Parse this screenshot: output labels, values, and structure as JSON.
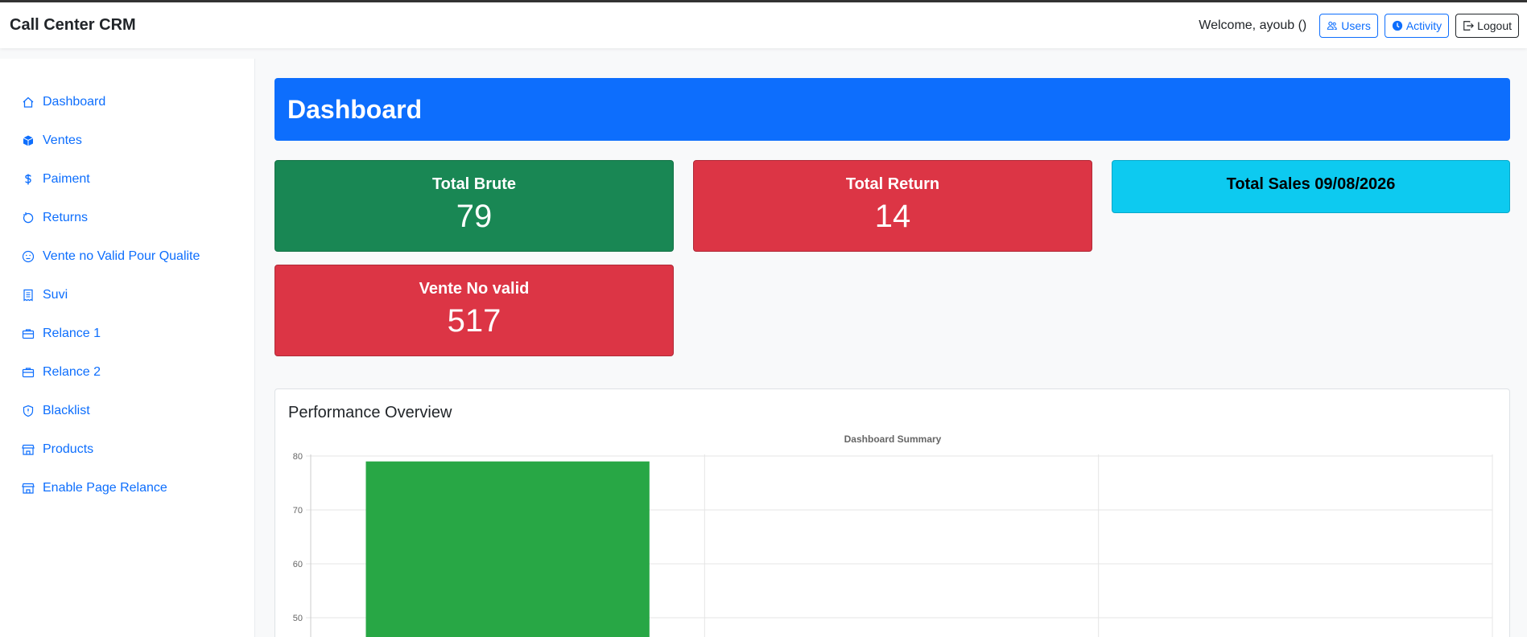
{
  "app": {
    "title": "Call Center CRM"
  },
  "header": {
    "welcome": "Welcome, ayoub ()",
    "buttons": {
      "users": "Users",
      "activity": "Activity",
      "logout": "Logout"
    }
  },
  "sidebar": {
    "items": [
      {
        "label": "Dashboard",
        "icon": "home-icon"
      },
      {
        "label": "Ventes",
        "icon": "box-icon"
      },
      {
        "label": "Paiment",
        "icon": "dollar-icon"
      },
      {
        "label": "Returns",
        "icon": "refresh-icon"
      },
      {
        "label": "Vente no Valid Pour Qualite",
        "icon": "neutral-face-icon"
      },
      {
        "label": "Suvi",
        "icon": "receipt-icon"
      },
      {
        "label": "Relance 1",
        "icon": "briefcase-icon"
      },
      {
        "label": "Relance 2",
        "icon": "briefcase-icon"
      },
      {
        "label": "Blacklist",
        "icon": "shield-icon"
      },
      {
        "label": "Products",
        "icon": "shop-icon"
      },
      {
        "label": "Enable Page Relance",
        "icon": "shop-icon"
      }
    ]
  },
  "page": {
    "title": "Dashboard"
  },
  "cards": {
    "total_brute": {
      "title": "Total Brute",
      "value": "79"
    },
    "total_return": {
      "title": "Total Return",
      "value": "14"
    },
    "total_sales": {
      "title": "Total Sales 09/08/2026"
    },
    "vente_no_valid": {
      "title": "Vente No valid",
      "value": "517"
    }
  },
  "colors": {
    "primary": "#0d6efd",
    "success": "#198754",
    "danger": "#dc3545",
    "info": "#0dcaf0",
    "bar": "#28a745"
  },
  "performance": {
    "title": "Performance Overview"
  },
  "chart_data": {
    "type": "bar",
    "title": "Dashboard Summary",
    "categories_visible": 3,
    "values": [
      79
    ],
    "bar_color": "#28a745",
    "y_ticks": [
      80,
      70,
      60,
      50
    ],
    "grid": true
  }
}
